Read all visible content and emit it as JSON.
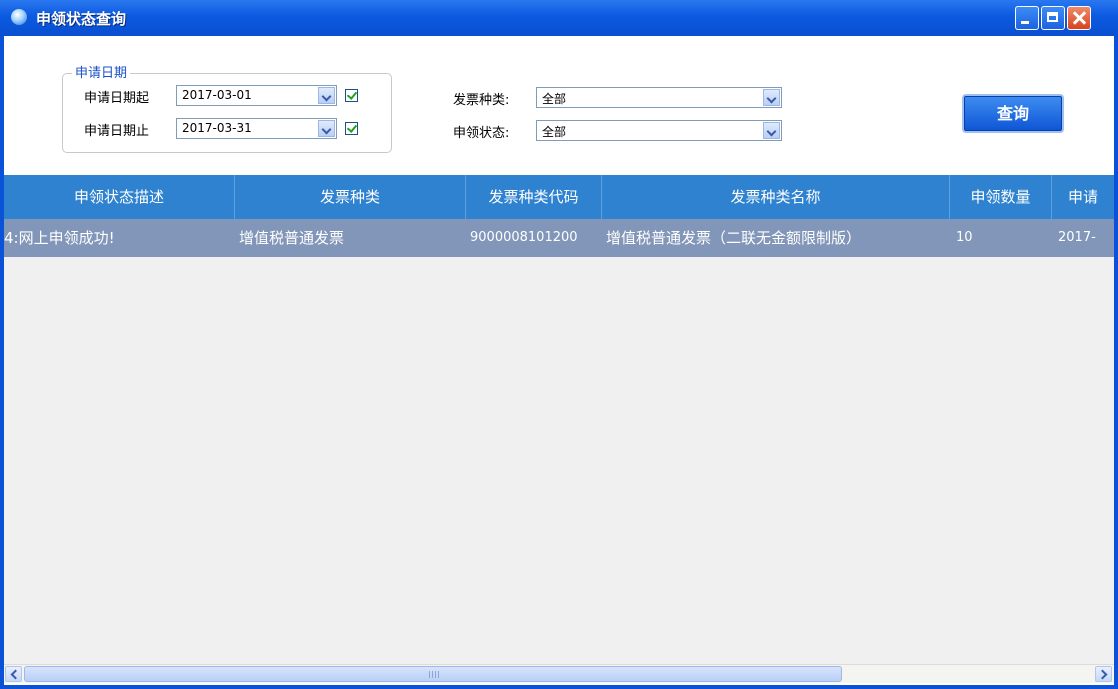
{
  "window": {
    "title": "申领状态查询"
  },
  "filter": {
    "group_legend": "申请日期",
    "date_start_label": "申请日期起",
    "date_start_value": "2017-03-01",
    "date_start_checked": true,
    "date_end_label": "申请日期止",
    "date_end_value": "2017-03-31",
    "date_end_checked": true,
    "invoice_type_label": "发票种类:",
    "invoice_type_value": "全部",
    "status_label": "申领状态:",
    "status_value": "全部",
    "query_label": "查询"
  },
  "table": {
    "columns": [
      "申领状态描述",
      "发票种类",
      "发票种类代码",
      "发票种类名称",
      "申领数量",
      "申请"
    ],
    "rows": [
      [
        "4:网上申领成功!",
        "增值税普通发票",
        "9000008101200",
        "增值税普通发票（二联无金额限制版）",
        "10",
        "2017-"
      ]
    ]
  },
  "colors": {
    "header_bg": "#2e82cf",
    "row_selected_bg": "#8196b8",
    "titlebar": "#0a52d8"
  }
}
